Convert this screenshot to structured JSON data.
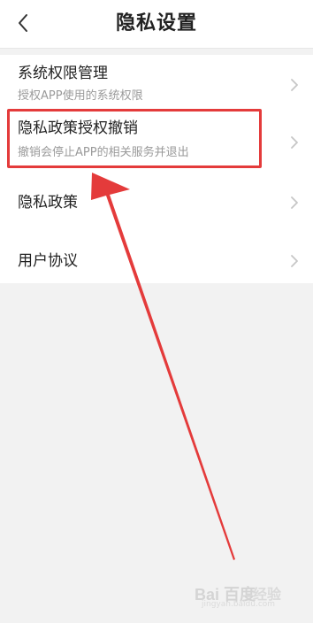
{
  "header": {
    "title": "隐私设置",
    "back_icon": "chevron-left-icon"
  },
  "settings": {
    "items": [
      {
        "title": "系统权限管理",
        "subtitle": "授权APP使用的系统权限"
      },
      {
        "title": "隐私政策授权撤销",
        "subtitle": "撤销会停止APP的相关服务并退出"
      },
      {
        "title": "隐私政策",
        "subtitle": ""
      },
      {
        "title": "用户协议",
        "subtitle": ""
      }
    ]
  },
  "annotation": {
    "highlight_color": "#e43b3b",
    "highlighted_item": "隐私政策授权撤销"
  },
  "watermark": {
    "logo": "Bai 百度",
    "text": "经验",
    "url": "jingyan.baidu.com"
  },
  "colors": {
    "background": "#f2f2f2",
    "card": "#ffffff",
    "title": "#222222",
    "subtitle": "#9a9a9a",
    "chevron": "#c6c6c6"
  }
}
